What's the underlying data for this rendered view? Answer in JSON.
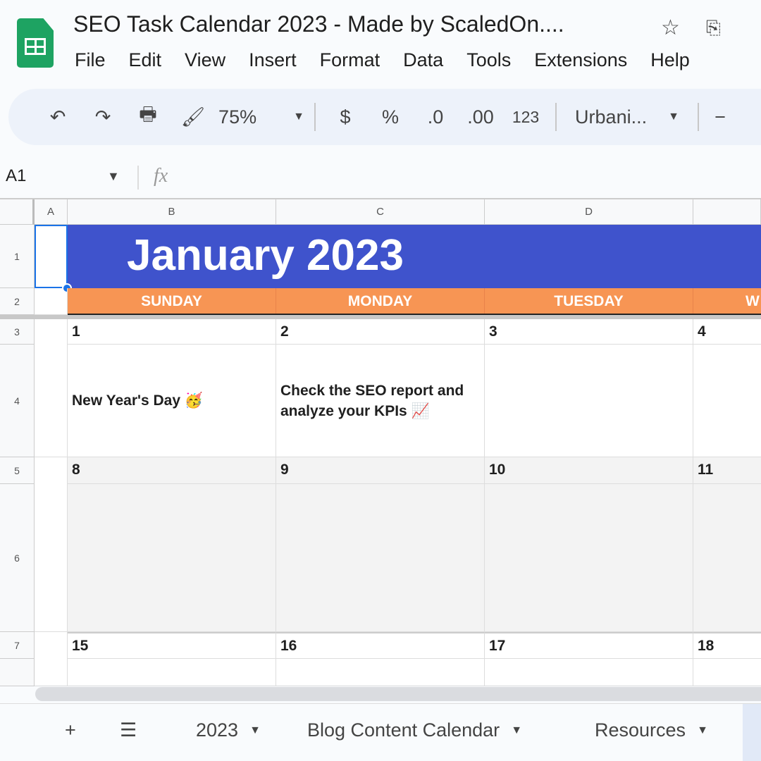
{
  "app": {
    "title": "SEO Task Calendar 2023 - Made by ScaledOn....",
    "menu": [
      "File",
      "Edit",
      "View",
      "Insert",
      "Format",
      "Data",
      "Tools",
      "Extensions",
      "Help"
    ],
    "accent": "#1ea362"
  },
  "toolbar": {
    "zoom": "75%",
    "currency": "$",
    "percent": "%",
    "dec_decrease": ".0",
    "dec_increase": ".00",
    "number_format": "123",
    "font": "Urbani...",
    "minus": "−"
  },
  "formula_bar": {
    "cell_ref": "A1",
    "fx": "fx",
    "value": ""
  },
  "sheet": {
    "columns": [
      "A",
      "B",
      "C",
      "D"
    ],
    "rows": [
      "1",
      "2",
      "3",
      "4",
      "5",
      "6",
      "7"
    ],
    "month_title": "January 2023",
    "days": [
      "SUNDAY",
      "MONDAY",
      "TUESDAY",
      "W"
    ],
    "week1": {
      "dates": [
        "1",
        "2",
        "3",
        "4"
      ],
      "tasks": [
        "New Year's Day 🥳",
        "Check the SEO report and analyze your KPIs 📈",
        "",
        ""
      ]
    },
    "week2": {
      "dates": [
        "8",
        "9",
        "10",
        "11"
      ]
    },
    "week3": {
      "dates": [
        "15",
        "16",
        "17",
        "18"
      ]
    },
    "colors": {
      "header_blue": "#3f53cc",
      "day_orange": "#f79554",
      "week_gray": "#f3f3f3"
    }
  },
  "tabs": {
    "add": "+",
    "list": "☰",
    "items": [
      "2023",
      "Blog Content Calendar",
      "Resources"
    ]
  }
}
